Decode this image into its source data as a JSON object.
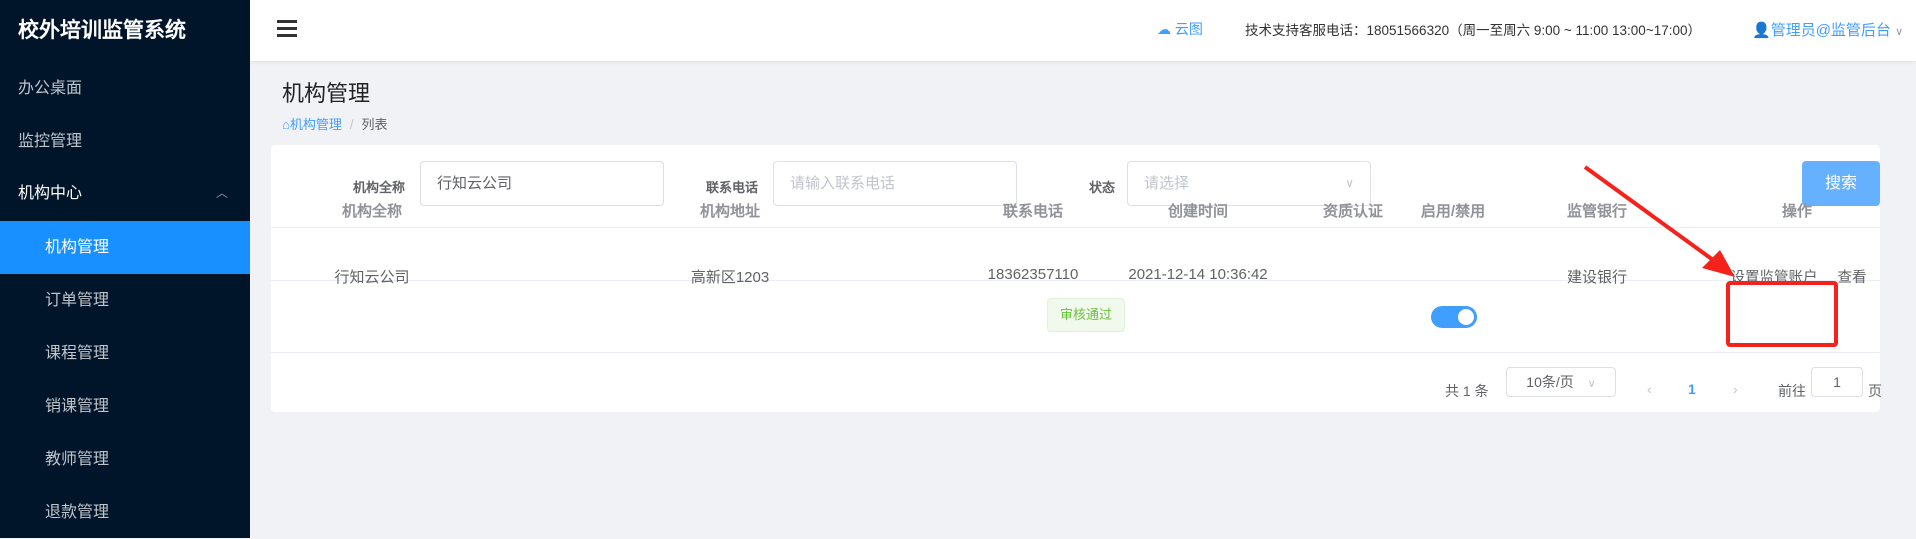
{
  "sidebar": {
    "title": "校外培训监管系统",
    "items": [
      {
        "label": "办公桌面"
      },
      {
        "label": "监控管理"
      },
      {
        "label": "机构中心"
      },
      {
        "label": "机构管理"
      },
      {
        "label": "订单管理"
      },
      {
        "label": "课程管理"
      },
      {
        "label": "销课管理"
      },
      {
        "label": "教师管理"
      },
      {
        "label": "退款管理"
      }
    ]
  },
  "header": {
    "cloud": "云图",
    "support": "技术支持客服电话：18051566320（周一至周六 9:00 ~ 11:00 13:00~17:00）",
    "user": "管理员@监管后台"
  },
  "page": {
    "title": "机构管理",
    "breadcrumb": [
      "机构管理",
      "列表"
    ]
  },
  "search": {
    "name_label": "机构全称",
    "name_value": "行知云公司",
    "phone_label": "联系电话",
    "phone_placeholder": "请输入联系电话",
    "status_label": "状态",
    "status_placeholder": "请选择",
    "button": "搜索"
  },
  "table": {
    "headers": [
      "机构全称",
      "机构地址",
      "联系电话",
      "创建时间",
      "资质认证",
      "启用/禁用",
      "监管银行",
      "操作"
    ],
    "rows": [
      {
        "name": "行知云公司",
        "address": "高新区1203",
        "phone": "18362357110",
        "created": "2021-12-14 10:36:42",
        "cert": "审核通过",
        "enabled": true,
        "bank": "建设银行",
        "action1": "设置监管账户",
        "action2": "查看"
      }
    ]
  },
  "pagination": {
    "total": "共 1 条",
    "page_size": "10条/页",
    "current": "1",
    "goto_label": "前往",
    "goto_value": "1",
    "page_suffix": "页"
  },
  "colors": {
    "sidebar": "#001529",
    "accent": "#1890ff",
    "annotation": "#f5221b"
  }
}
